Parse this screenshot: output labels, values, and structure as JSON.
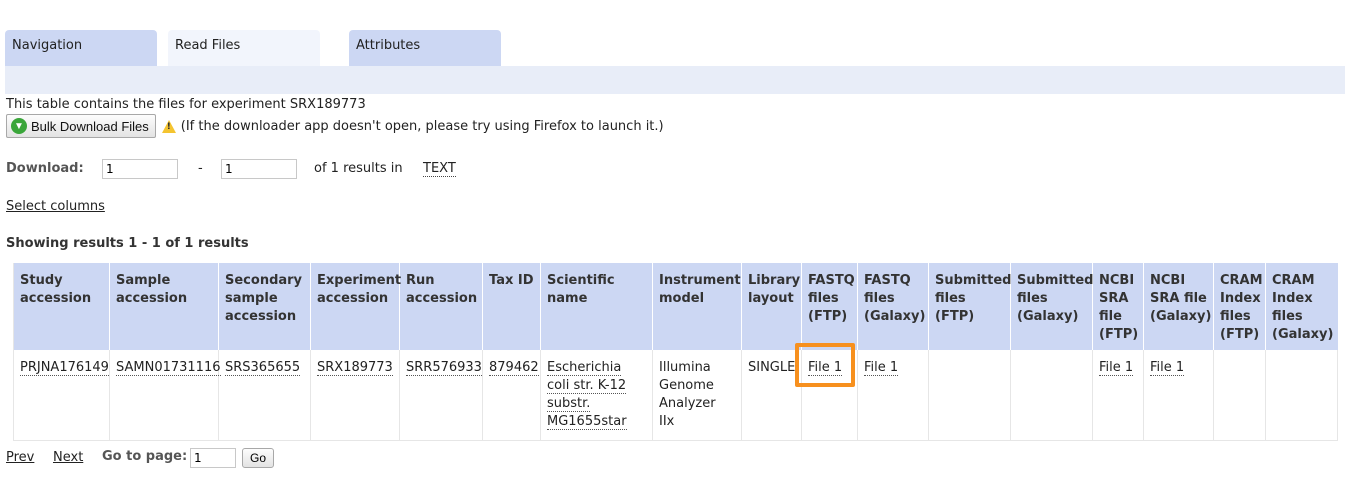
{
  "tabs": [
    {
      "label": "Navigation"
    },
    {
      "label": "Read Files"
    },
    {
      "label": "Attributes"
    }
  ],
  "active_tab": "Read Files",
  "intro_text": "This table contains the files for experiment SRX189773",
  "bulk": {
    "button_label": "Bulk Download Files",
    "icon": "download-arrow-icon",
    "warning_icon": "warning-icon",
    "note": "(If the downloader app doesn't open, please try using Firefox to launch it.)"
  },
  "download": {
    "label": "Download:",
    "from_value": "1",
    "dash": "-",
    "to_value": "1",
    "of_text": "of 1 results in",
    "format_link": "TEXT"
  },
  "select_columns": "Select columns",
  "showing": "Showing results 1 - 1 of 1 results",
  "table": {
    "headers": [
      "Study accession",
      "Sample accession",
      "Secondary sample accession",
      "Experiment accession",
      "Run accession",
      "Tax ID",
      "Scientific name",
      "Instrument model",
      "Library layout",
      "FASTQ files (FTP)",
      "FASTQ files (Galaxy)",
      "Submitted files (FTP)",
      "Submitted files (Galaxy)",
      "NCBI SRA file (FTP)",
      "NCBI SRA file (Galaxy)",
      "CRAM Index files (FTP)",
      "CRAM Index files (Galaxy)"
    ],
    "row": {
      "study": "PRJNA176149",
      "sample": "SAMN01731116",
      "secondary_sample": "SRS365655",
      "experiment": "SRX189773",
      "run": "SRR576933",
      "tax_id": "879462",
      "scientific_name": "Escherichia coli str. K-12 substr. MG1655star",
      "instrument": "Illumina Genome Analyzer IIx",
      "layout": "SINGLE",
      "fastq_ftp": "File 1",
      "fastq_galaxy": "File 1",
      "submitted_ftp": "",
      "submitted_galaxy": "",
      "sra_ftp": "File 1",
      "sra_galaxy": "File 1",
      "cram_ftp": "",
      "cram_galaxy": ""
    }
  },
  "highlight_color": "#f7901e",
  "pager": {
    "prev": "Prev",
    "next": "Next",
    "goto_label": "Go to page:",
    "page_value": "1",
    "go_button": "Go"
  }
}
